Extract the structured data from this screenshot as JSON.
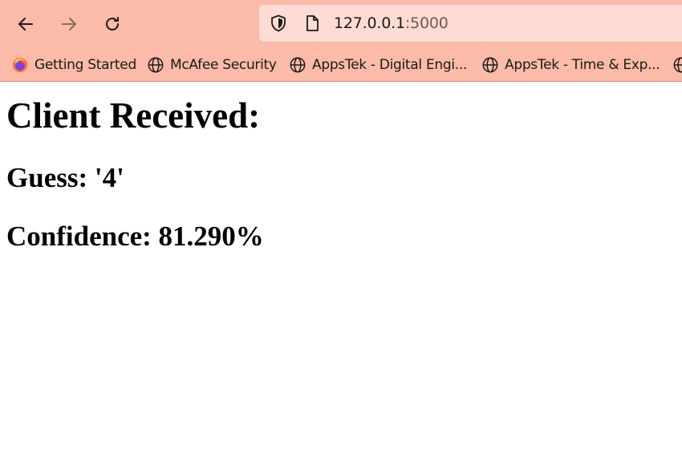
{
  "browser": {
    "nav": {
      "back_icon": "arrow-left-icon",
      "forward_icon": "arrow-right-icon",
      "reload_icon": "reload-icon"
    },
    "url": {
      "host": "127.0.0.1",
      "port": ":5000"
    },
    "bookmarks": [
      {
        "label": "Getting Started",
        "icon": "firefox-icon"
      },
      {
        "label": "McAfee Security",
        "icon": "globe-icon"
      },
      {
        "label": "AppsTek - Digital Engi...",
        "icon": "globe-icon"
      },
      {
        "label": "AppsTek - Time & Exp...",
        "icon": "globe-icon"
      }
    ],
    "colors": {
      "toolbar_bg": "#fcbaa9",
      "urlbar_bg": "#fedcd3"
    }
  },
  "page": {
    "heading": "Client Received:",
    "guess": "Guess: '4'",
    "confidence": "Confidence: 81.290%"
  }
}
